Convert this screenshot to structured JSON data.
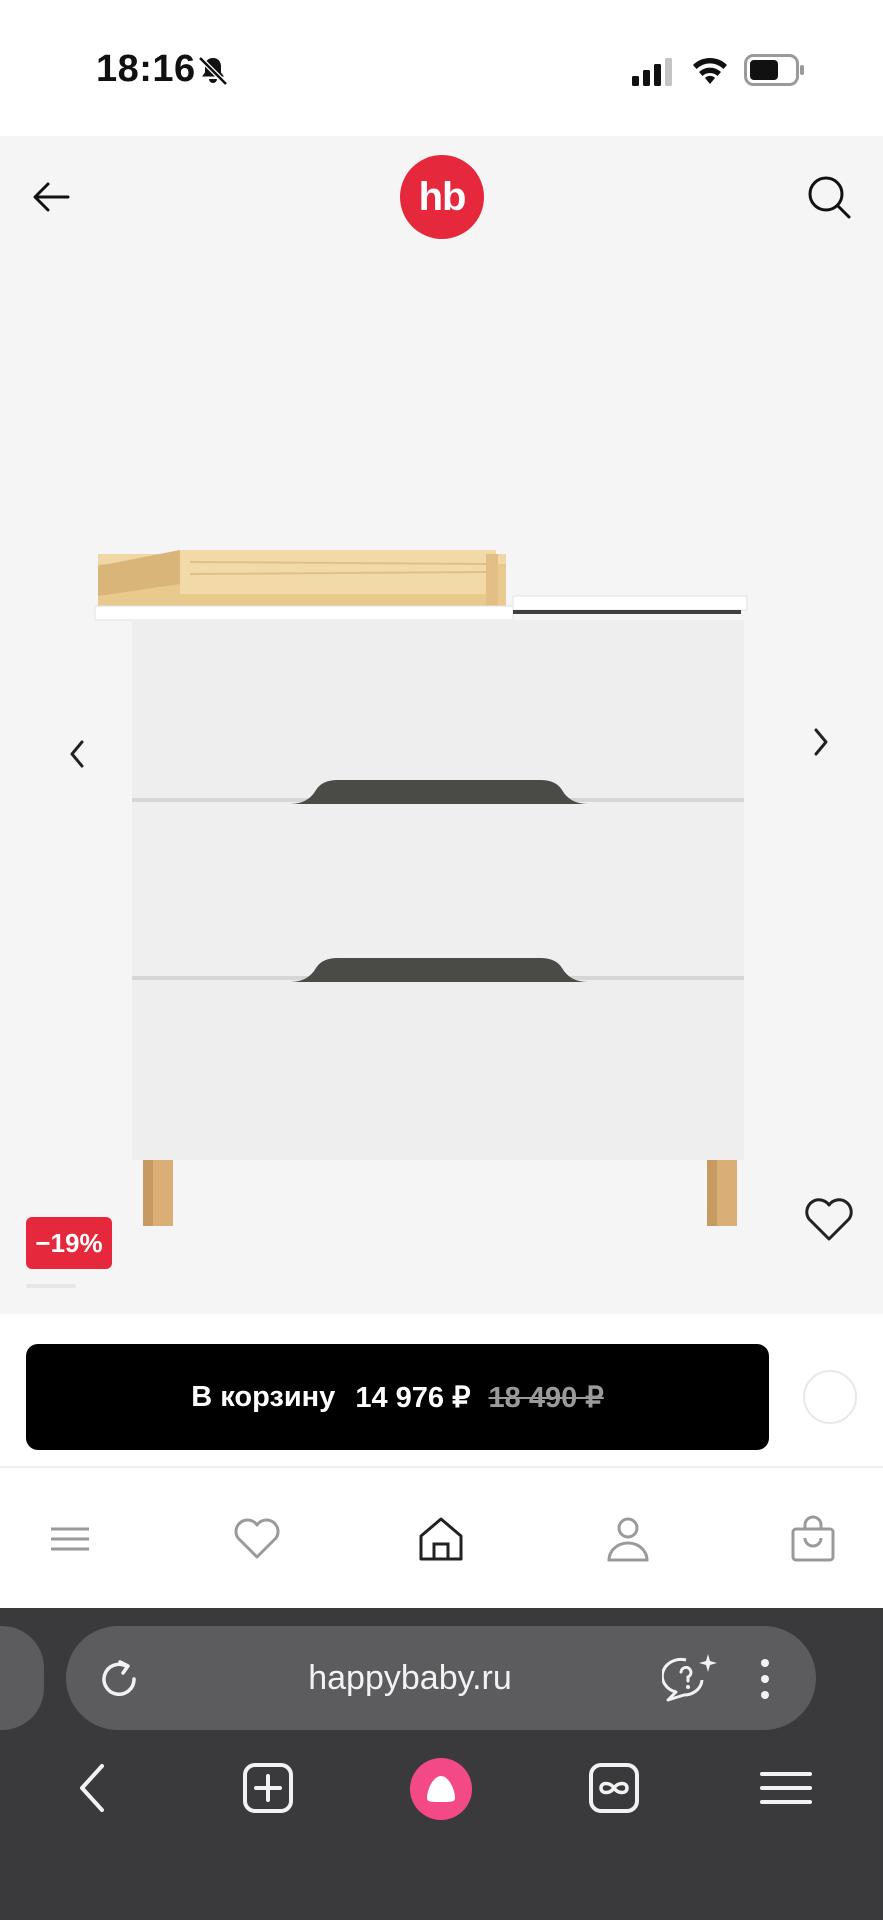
{
  "status_bar": {
    "time": "18:16",
    "icons": [
      "bell-slash-icon",
      "cellular-signal-icon",
      "wifi-icon",
      "battery-icon"
    ]
  },
  "product": {
    "icons": {
      "back": "arrow-left-icon",
      "search": "search-icon",
      "favorite": "heart-icon"
    },
    "logo_text": "hb",
    "discount": "−19%",
    "brand_color": "#e5283c"
  },
  "cart": {
    "label": "В корзину",
    "price": "14 976 ₽",
    "old_price": "18 490 ₽"
  },
  "site_nav": {
    "items": [
      "menu-icon",
      "heart-icon",
      "home-icon",
      "profile-icon",
      "cart-bag-icon"
    ],
    "active": "home-icon"
  },
  "browser": {
    "url": "happybaby.ru",
    "accent": "#f34a87",
    "toolbar": [
      "back-icon",
      "new-tab-icon",
      "alice-icon",
      "tabs-icon",
      "hamburger-icon"
    ]
  }
}
